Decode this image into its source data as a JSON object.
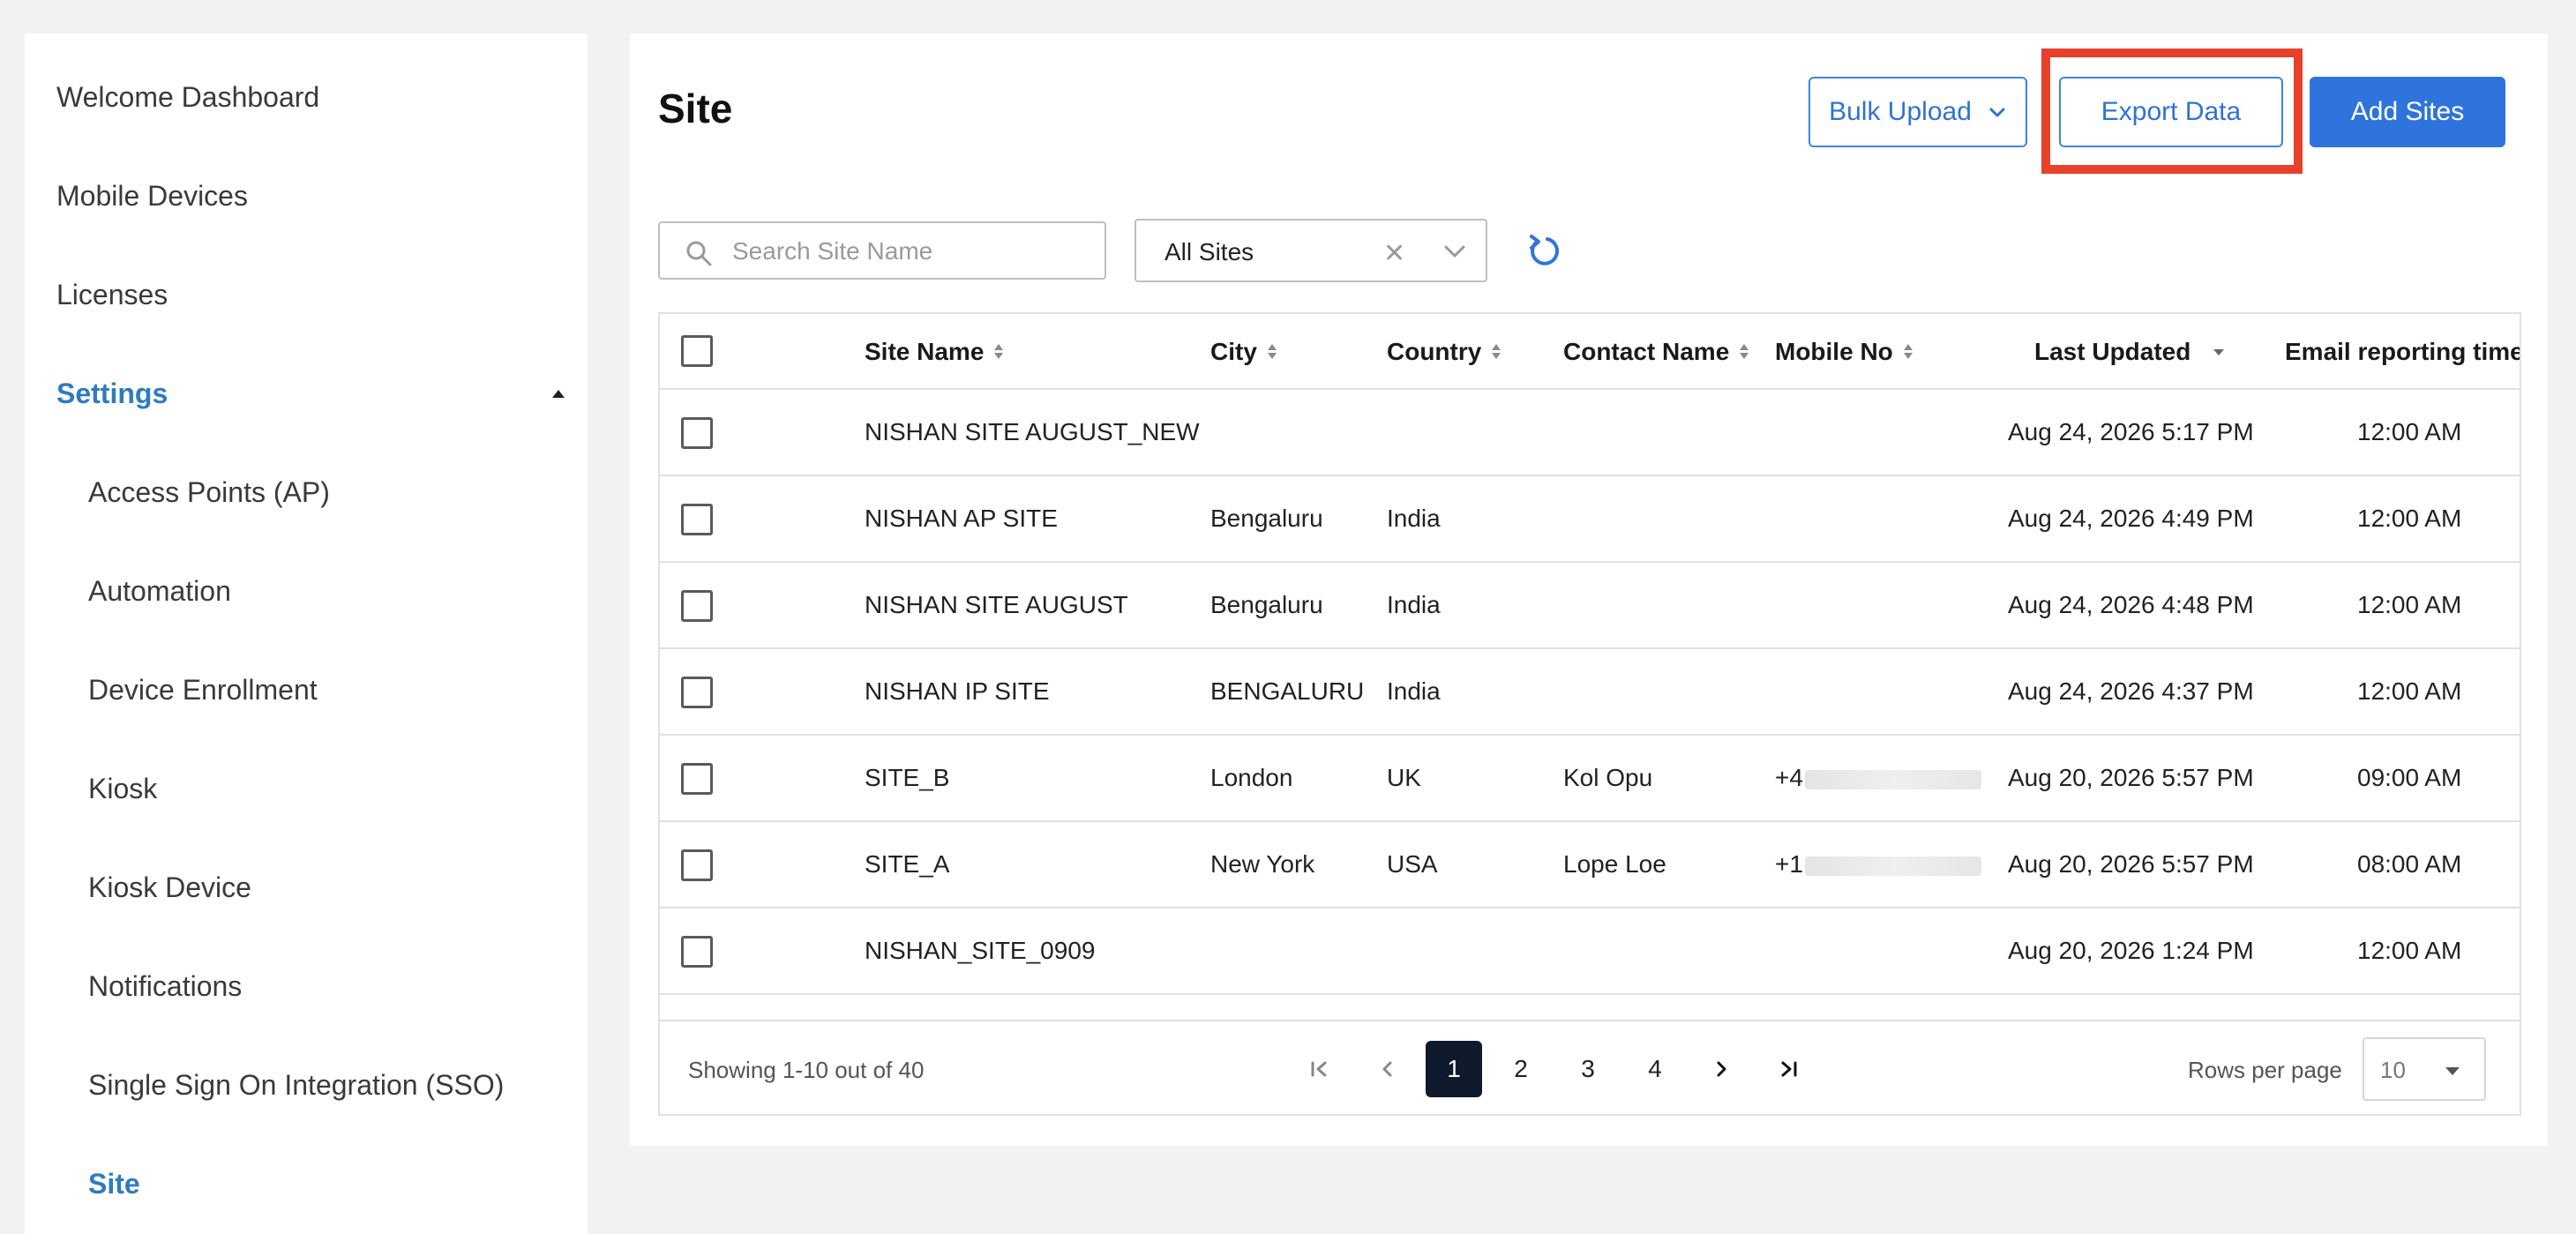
{
  "sidebar": {
    "items": [
      {
        "label": "Welcome Dashboard"
      },
      {
        "label": "Mobile Devices"
      },
      {
        "label": "Licenses"
      },
      {
        "label": "Settings"
      },
      {
        "label": "Access Points (AP)"
      },
      {
        "label": "Automation"
      },
      {
        "label": "Device Enrollment"
      },
      {
        "label": "Kiosk"
      },
      {
        "label": "Kiosk Device"
      },
      {
        "label": "Notifications"
      },
      {
        "label": "Single Sign On Integration (SSO)"
      },
      {
        "label": "Site"
      }
    ]
  },
  "header": {
    "title": "Site",
    "bulk_upload_label": "Bulk Upload",
    "export_label": "Export Data",
    "add_label": "Add Sites"
  },
  "filters": {
    "search_placeholder": "Search Site Name",
    "select_value": "All Sites",
    "clear_glyph": "✕"
  },
  "table": {
    "columns": [
      "Site Name",
      "City",
      "Country",
      "Contact Name",
      "Mobile No",
      "Last Updated",
      "Email reporting time"
    ],
    "rows": [
      {
        "site": "NISHAN SITE AUGUST_NEW",
        "city": "",
        "country": "",
        "contact": "",
        "mobile": "",
        "updated": "Aug 24, 2026 5:17 PM",
        "time": "12:00 AM"
      },
      {
        "site": "NISHAN AP SITE",
        "city": "Bengaluru",
        "country": "India",
        "contact": "",
        "mobile": "",
        "updated": "Aug 24, 2026 4:49 PM",
        "time": "12:00 AM"
      },
      {
        "site": "NISHAN SITE AUGUST",
        "city": "Bengaluru",
        "country": "India",
        "contact": "",
        "mobile": "",
        "updated": "Aug 24, 2026 4:48 PM",
        "time": "12:00 AM"
      },
      {
        "site": "NISHAN IP SITE",
        "city": "BENGALURU",
        "country": "India",
        "contact": "",
        "mobile": "",
        "updated": "Aug 24, 2026 4:37 PM",
        "time": "12:00 AM"
      },
      {
        "site": "SITE_B",
        "city": "London",
        "country": "UK",
        "contact": "Kol Opu",
        "mobile": "+4",
        "updated": "Aug 20, 2026 5:57 PM",
        "time": "09:00 AM"
      },
      {
        "site": "SITE_A",
        "city": "New York",
        "country": "USA",
        "contact": "Lope Loe",
        "mobile": "+1",
        "updated": "Aug 20, 2026 5:57 PM",
        "time": "08:00 AM"
      },
      {
        "site": "NISHAN_SITE_0909",
        "city": "",
        "country": "",
        "contact": "",
        "mobile": "",
        "updated": "Aug 20, 2026 1:24 PM",
        "time": "12:00 AM"
      }
    ]
  },
  "pagination": {
    "showing": "Showing 1-10 out of 40",
    "pages": [
      "1",
      "2",
      "3",
      "4"
    ],
    "current": "1",
    "rows_per_page_label": "Rows per page",
    "rows_per_page_value": "10"
  },
  "colors": {
    "accent": "#2f74dc",
    "highlight": "#e8412b",
    "active_nav": "#2f7bc0"
  }
}
